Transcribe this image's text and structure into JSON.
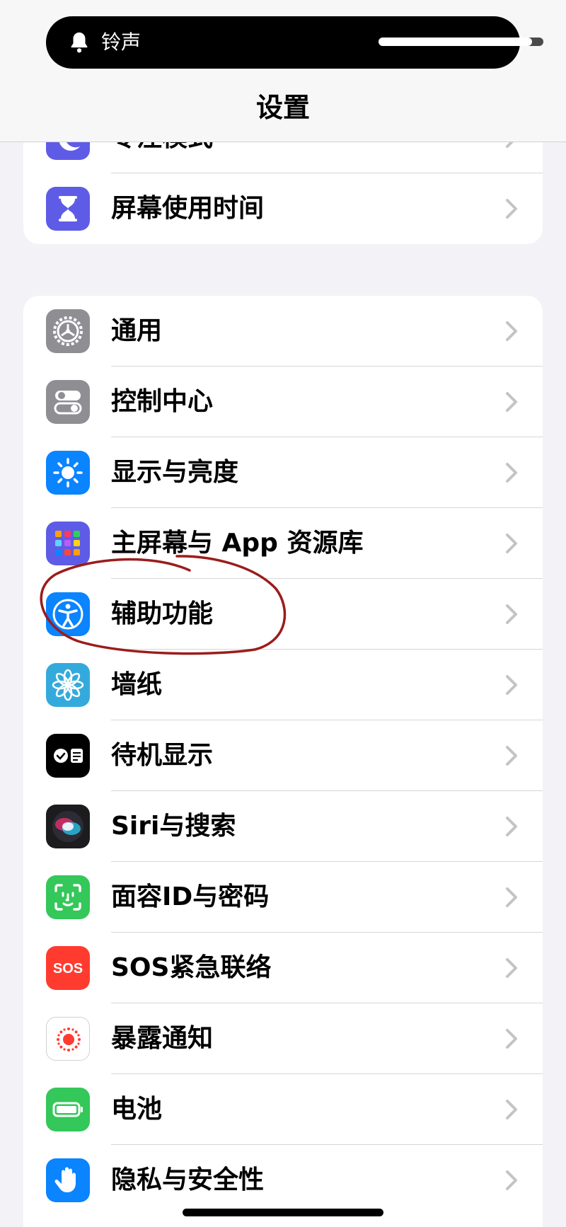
{
  "status": {
    "ringer_label": "铃声",
    "volume_level": 0.93
  },
  "header": {
    "title": "设置"
  },
  "group1": {
    "items": [
      {
        "label": "专注模式",
        "color": "#5e5ce6",
        "icon": "moon-icon"
      },
      {
        "label": "屏幕使用时间",
        "color": "#5e5ce6",
        "icon": "hourglass-icon"
      }
    ]
  },
  "group2": {
    "items": [
      {
        "label": "通用",
        "color": "#8e8e93",
        "icon": "gear-icon"
      },
      {
        "label": "控制中心",
        "color": "#8e8e93",
        "icon": "toggles-icon"
      },
      {
        "label": "显示与亮度",
        "color": "#0a84ff",
        "icon": "sun-icon"
      },
      {
        "label": "主屏幕与 App 资源库",
        "color": "#5e5ce6",
        "icon": "app-grid-icon"
      },
      {
        "label": "辅助功能",
        "color": "#0a84ff",
        "icon": "accessibility-icon"
      },
      {
        "label": "墙纸",
        "color": "#34aadc",
        "icon": "flower-icon"
      },
      {
        "label": "待机显示",
        "color": "#000000",
        "icon": "standby-icon"
      },
      {
        "label": "Siri与搜索",
        "color": "#1c1c1e",
        "icon": "siri-icon"
      },
      {
        "label": "面容ID与密码",
        "color": "#34c759",
        "icon": "face-id-icon"
      },
      {
        "label": "SOS紧急联络",
        "color": "#ff3b30",
        "icon": "sos-icon",
        "icon_text": "SOS"
      },
      {
        "label": "暴露通知",
        "color": "#ffffff",
        "icon": "exposure-icon"
      },
      {
        "label": "电池",
        "color": "#34c759",
        "icon": "battery-icon"
      },
      {
        "label": "隐私与安全性",
        "color": "#0a84ff",
        "icon": "hand-icon"
      }
    ]
  },
  "annotation": {
    "color": "#9b1c1c",
    "target": "辅助功能"
  }
}
